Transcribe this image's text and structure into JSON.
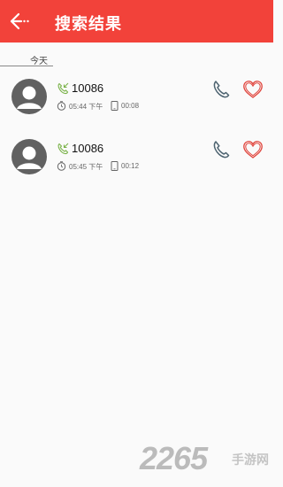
{
  "app_bar": {
    "title": "搜索结果",
    "back_icon": "arrow-left-icon",
    "background": "#f2423a"
  },
  "section": {
    "label": "今天"
  },
  "records": [
    {
      "number": "10086",
      "time": "05:44 下午",
      "duration": "00:08"
    },
    {
      "number": "10086",
      "time": "05:45 下午",
      "duration": "00:12"
    }
  ],
  "icons": {
    "call_type": "incoming-call-icon",
    "time": "clock-icon",
    "duration": "phone-device-icon",
    "call_action": "phone-icon",
    "favorite_action": "heart-icon"
  },
  "colors": {
    "call_icon": "#4d6370",
    "heart": "#e0443c",
    "incoming": "#7bb34a"
  },
  "watermark": {
    "digits": "2265",
    "text": "手游网"
  }
}
